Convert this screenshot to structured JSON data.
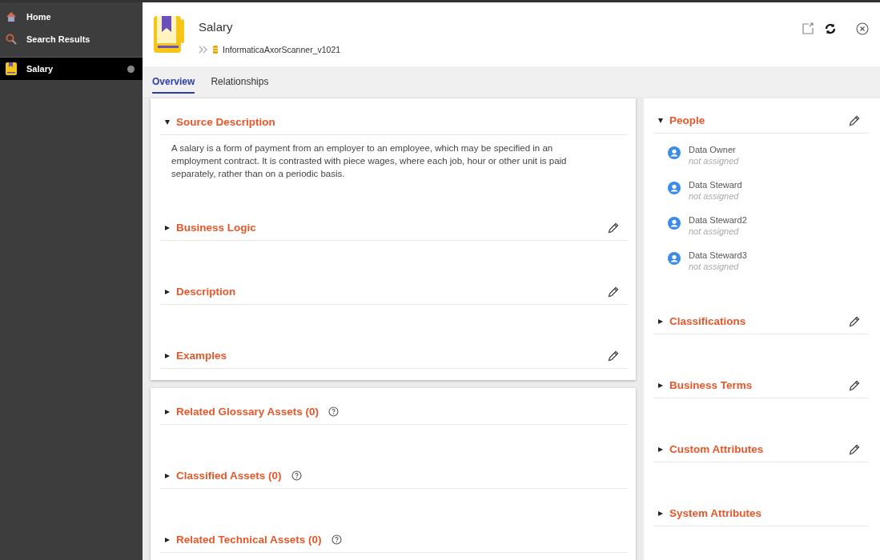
{
  "sidebar": {
    "items": [
      {
        "label": "Home",
        "kind": "home",
        "selected": false
      },
      {
        "label": "Search Results",
        "kind": "search",
        "selected": false
      },
      {
        "label": "Salary",
        "kind": "asset",
        "selected": true
      }
    ]
  },
  "header": {
    "title": "Salary",
    "breadcrumb": "InformaticaAxorScanner_v1021"
  },
  "tabs": [
    {
      "label": "Overview",
      "selected": true
    },
    {
      "label": "Relationships",
      "selected": false
    }
  ],
  "main_card": {
    "sections": [
      {
        "title": "Source Description",
        "expanded": true,
        "editable": false,
        "help": false,
        "text": "A salary is a form of payment from an employer to an employee, which may be specified in an employment contract. It is contrasted with piece wages, where each job, hour or other unit is paid separately, rather than on a periodic basis."
      },
      {
        "title": "Business Logic",
        "expanded": false,
        "editable": true,
        "help": false
      },
      {
        "title": "Description",
        "expanded": false,
        "editable": true,
        "help": false
      },
      {
        "title": "Examples",
        "expanded": false,
        "editable": true,
        "help": false
      }
    ]
  },
  "assets_card": {
    "sections": [
      {
        "title": "Related Glossary Assets (0)",
        "expanded": false,
        "editable": false,
        "help": true
      },
      {
        "title": "Classified Assets (0)",
        "expanded": false,
        "editable": false,
        "help": true
      },
      {
        "title": "Related Technical Assets (0)",
        "expanded": false,
        "editable": false,
        "help": true
      }
    ]
  },
  "side_panel": {
    "sections": [
      {
        "title": "People",
        "expanded": true,
        "editable": true,
        "help": false,
        "people": [
          {
            "role": "Data Owner",
            "value": "not assigned"
          },
          {
            "role": "Data Steward",
            "value": "not assigned"
          },
          {
            "role": "Data Steward2",
            "value": "not assigned"
          },
          {
            "role": "Data Steward3",
            "value": "not assigned"
          }
        ]
      },
      {
        "title": "Classifications",
        "expanded": false,
        "editable": true,
        "help": false
      },
      {
        "title": "Business Terms",
        "expanded": false,
        "editable": true,
        "help": false
      },
      {
        "title": "Custom Attributes",
        "expanded": false,
        "editable": true,
        "help": false
      },
      {
        "title": "System Attributes",
        "expanded": false,
        "editable": false,
        "help": false
      }
    ]
  }
}
